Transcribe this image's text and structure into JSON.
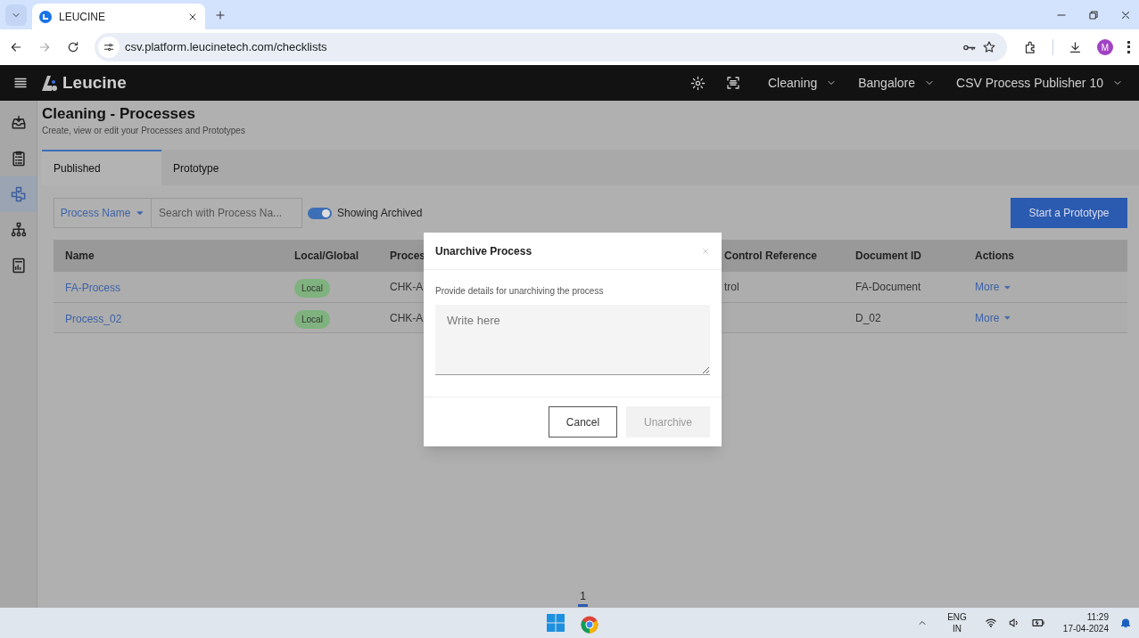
{
  "browser": {
    "tabs": [
      {
        "title": "LEUCINE",
        "selected": true
      }
    ],
    "url": "csv.platform.leucinetech.com/checklists",
    "profile": "M"
  },
  "app": {
    "brand": "Leucine",
    "menus": [
      "Cleaning",
      "Bangalore",
      "CSV Process Publisher 10"
    ]
  },
  "sidebar": {
    "items": [
      {
        "kind": "inbox",
        "selected": false
      },
      {
        "kind": "checklist",
        "selected": false
      },
      {
        "kind": "flow",
        "selected": true
      },
      {
        "kind": "hierarchy",
        "selected": false
      },
      {
        "kind": "report",
        "selected": false
      }
    ]
  },
  "page": {
    "title": "Cleaning - Processes",
    "subtitle": "Create, view or edit your Processes and Prototypes",
    "tabs": [
      {
        "label": "Published",
        "selected": true
      },
      {
        "label": "Prototype",
        "selected": false
      }
    ],
    "filter": {
      "label": "Process Name"
    },
    "search": {
      "placeholder": "Search with Process Na..."
    },
    "toggle": {
      "label": "Showing Archived",
      "on": true
    },
    "primary_button": "Start a Prototype",
    "table": {
      "columns": [
        "Name",
        "Local/Global",
        "Proces",
        "Control Reference",
        "Document ID",
        "Actions"
      ],
      "rows": [
        {
          "name": "FA-Process",
          "scope": "Local",
          "process": "CHK-A",
          "control": "trol",
          "document": "FA-Document",
          "action": "More"
        },
        {
          "name": "Process_02",
          "scope": "Local",
          "process": "CHK-A",
          "document": "D_02",
          "action": "More"
        }
      ]
    },
    "pagination": {
      "page": "1"
    }
  },
  "modal": {
    "title": "Unarchive Process",
    "prompt": "Provide details for unarchiving the process",
    "placeholder": "Write here",
    "buttons": [
      {
        "label": "Cancel",
        "disabled": false
      },
      {
        "label": "Unarchive",
        "disabled": true
      }
    ]
  },
  "taskbar": {
    "language": "ENG",
    "region": "IN",
    "time": "11:29",
    "date": "17-04-2024"
  }
}
